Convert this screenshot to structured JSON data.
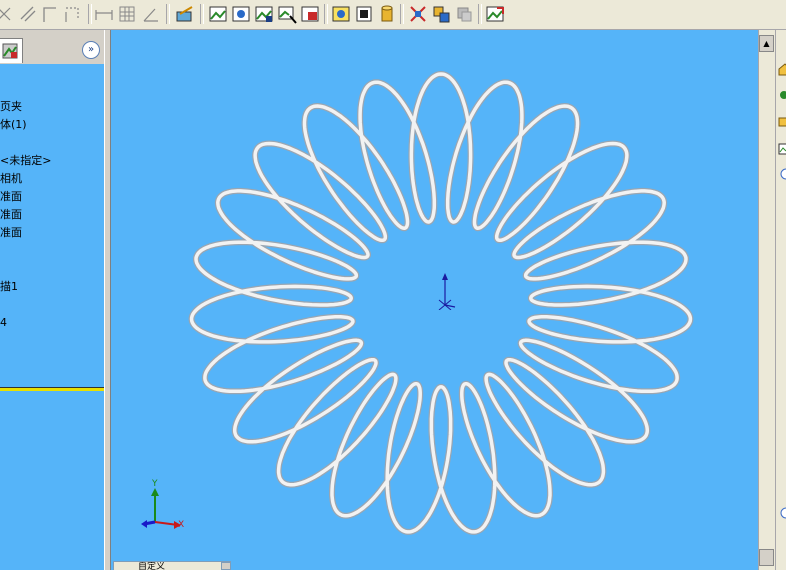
{
  "toolbar": {
    "icons": [
      "smart-dimension-icon",
      "relation-icon",
      "corner-icon",
      "trim-icon",
      "horizontal-dimension-icon",
      "grid-icon",
      "angle-icon",
      "edit-sketch-icon",
      "view-orient-icon",
      "display-style-icon",
      "section-view-icon",
      "zoom-area-icon",
      "zoom-fit-icon",
      "shaded-icon",
      "hidden-lines-icon",
      "cylinder-icon",
      "extrude-icon",
      "cut-icon",
      "fillet-icon",
      "rebuild-icon"
    ]
  },
  "feature_tree": {
    "items": [
      {
        "label": "页夹"
      },
      {
        "label": "体(1)"
      },
      {
        "label": "<未指定>"
      },
      {
        "label": "相机"
      },
      {
        "label": "准面"
      },
      {
        "label": "准面"
      },
      {
        "label": "准面"
      },
      {
        "label": "描1"
      },
      {
        "label": "4"
      }
    ]
  },
  "viewport": {
    "background": "#55b4f9",
    "model_color": "#f2f2f2"
  },
  "triad": {
    "y_label": "Y",
    "x_label": "X"
  },
  "config_tab": {
    "label": "自定义"
  }
}
